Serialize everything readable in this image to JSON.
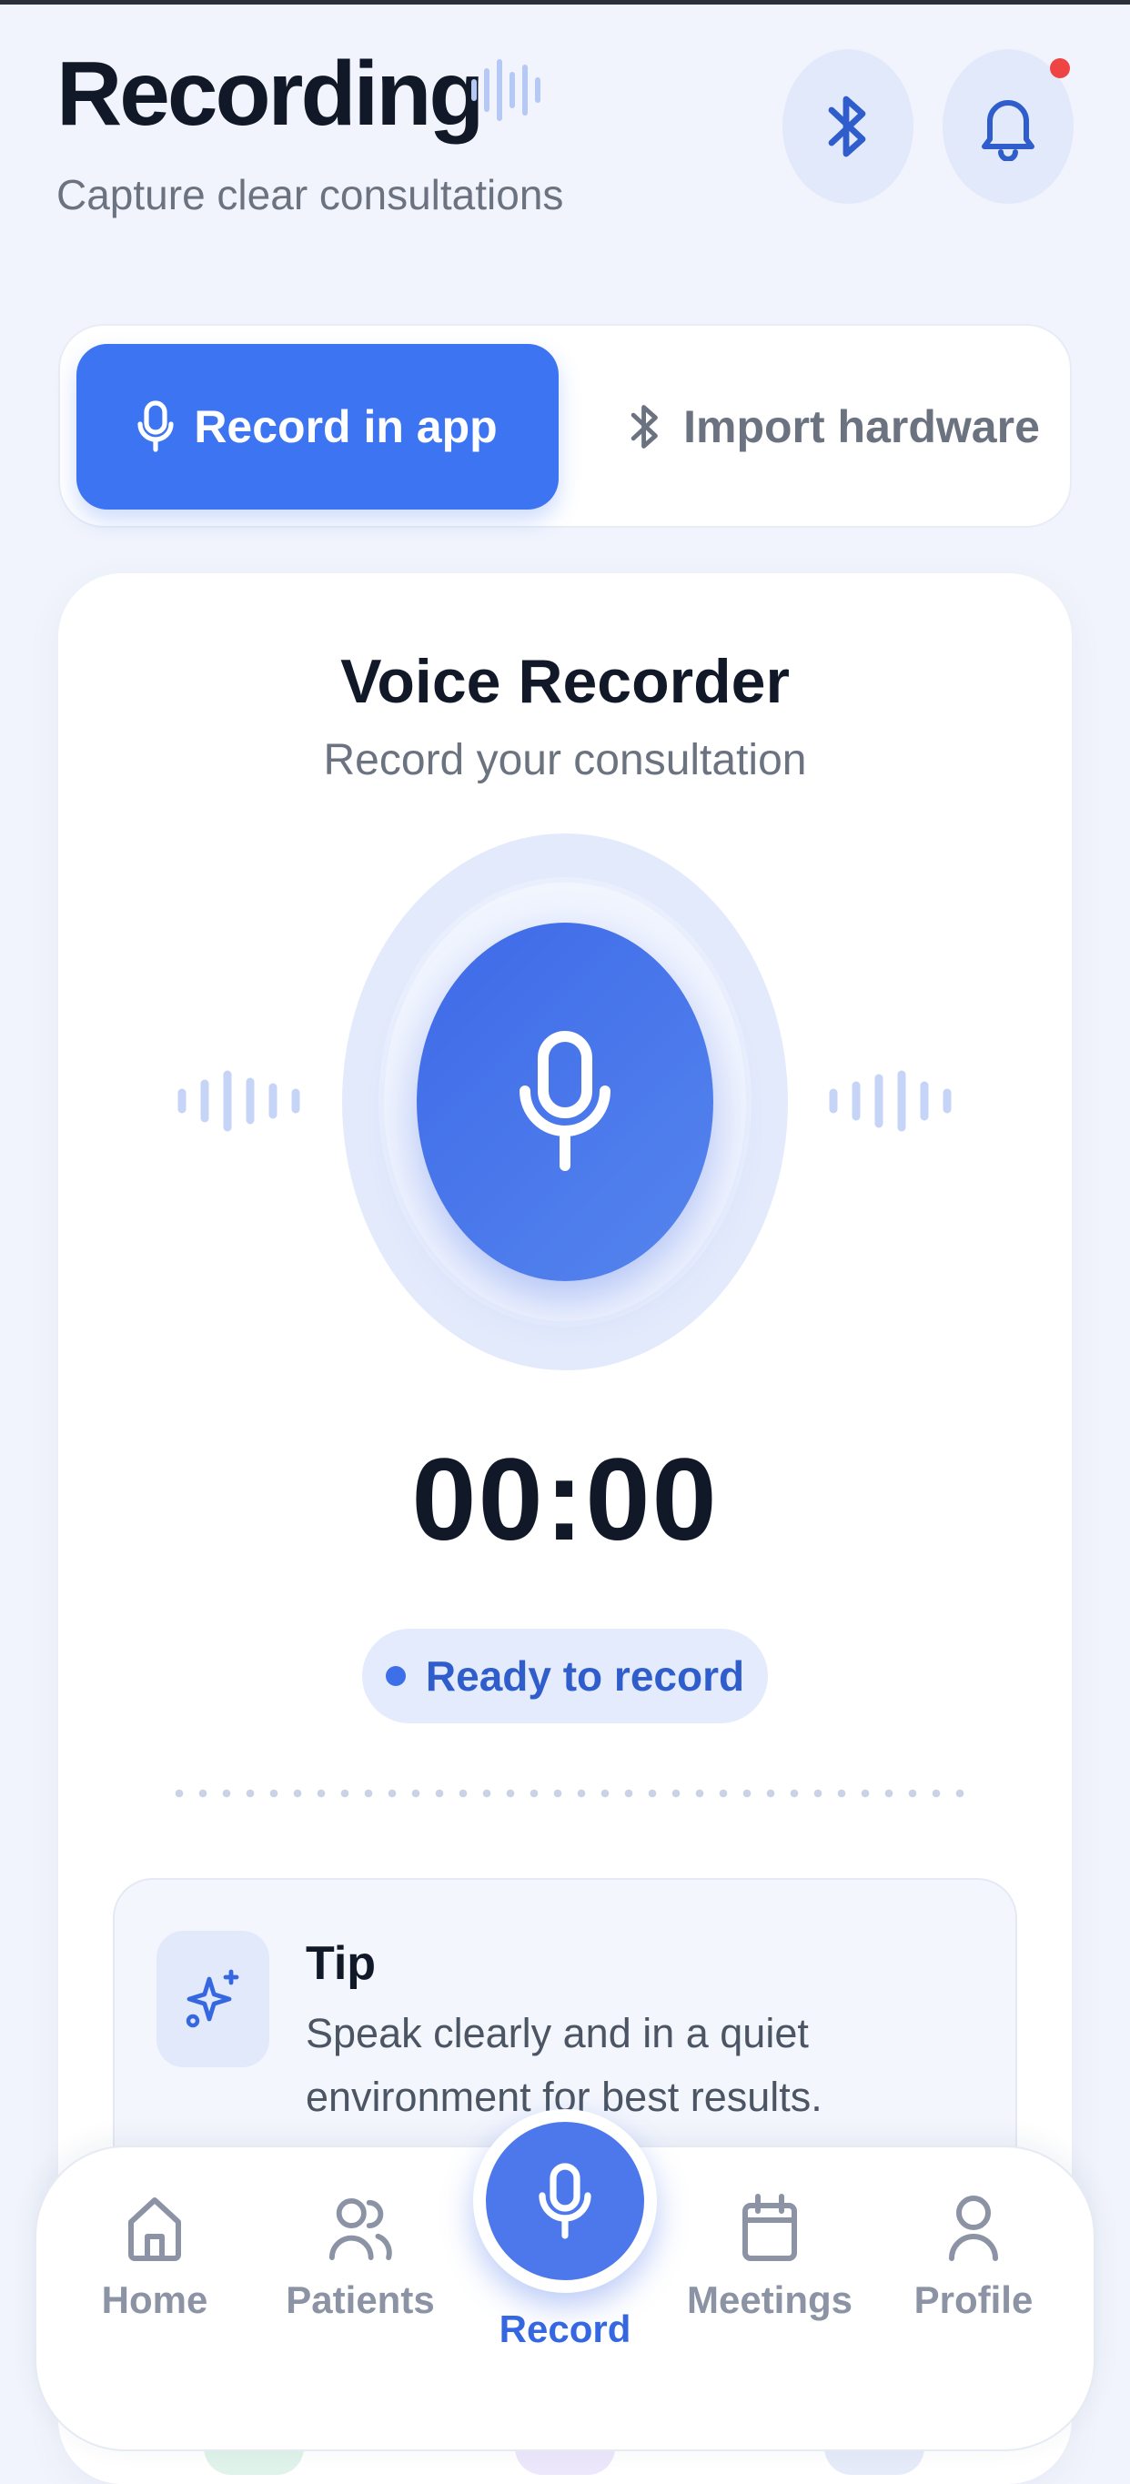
{
  "header": {
    "title": "Recording",
    "subtitle": "Capture clear consultations"
  },
  "icons": {
    "title_wave": "waveform-icon",
    "bluetooth": "bluetooth-icon",
    "bell": "bell-icon"
  },
  "segment": {
    "active_label": "Record in app",
    "inactive_label": "Import hardware"
  },
  "recorder": {
    "title": "Voice Recorder",
    "subtitle": "Record your consultation",
    "timer": "00:00",
    "status": "Ready to record"
  },
  "tip": {
    "title": "Tip",
    "text": "Speak clearly and in a quiet environment for best results."
  },
  "nav": {
    "home": "Home",
    "patients": "Patients",
    "record": "Record",
    "meetings": "Meetings",
    "profile": "Profile"
  },
  "colors": {
    "accent": "#3d74f2",
    "background": "#f1f4fc",
    "notification": "#ef4444"
  }
}
